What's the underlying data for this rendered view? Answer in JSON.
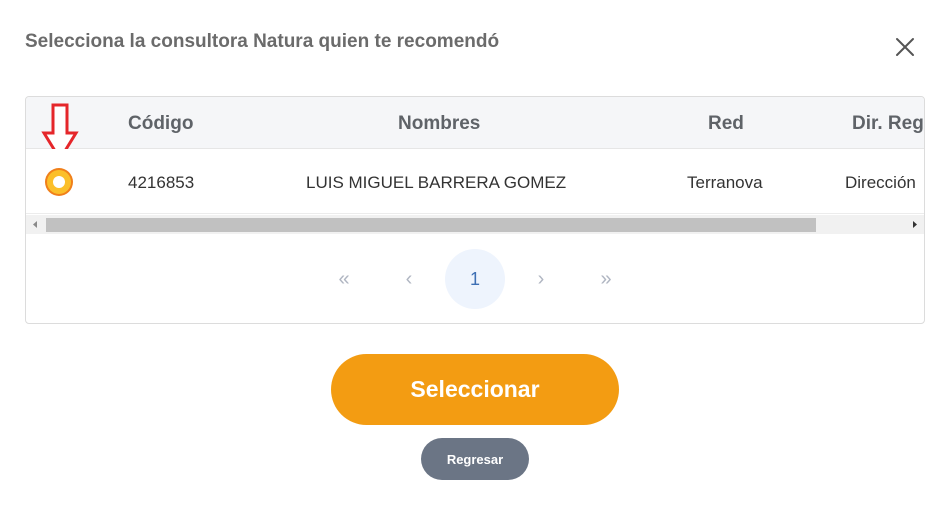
{
  "modal": {
    "title": "Selecciona la consultora Natura quien te recomendó",
    "close_icon": "close-icon"
  },
  "table": {
    "columns": [
      "Código",
      "Nombres",
      "Red",
      "Dir. Reg"
    ],
    "rows": [
      {
        "selected": true,
        "codigo": "4216853",
        "nombres": "LUIS MIGUEL BARRERA GOMEZ",
        "red": "Terranova",
        "dir_reg": "Dirección"
      }
    ],
    "annotation_icon": "red-down-arrow-icon"
  },
  "pagination": {
    "first_icon": "«",
    "prev_icon": "‹",
    "current_page": "1",
    "next_icon": "›",
    "last_icon": "»"
  },
  "actions": {
    "select_label": "Seleccionar",
    "back_label": "Regresar"
  },
  "colors": {
    "primary": "#f39c12",
    "secondary": "#6b7585",
    "radio_fill": "#fbbf2a",
    "radio_ring": "#f07f1a",
    "annotation": "#e5262a"
  }
}
